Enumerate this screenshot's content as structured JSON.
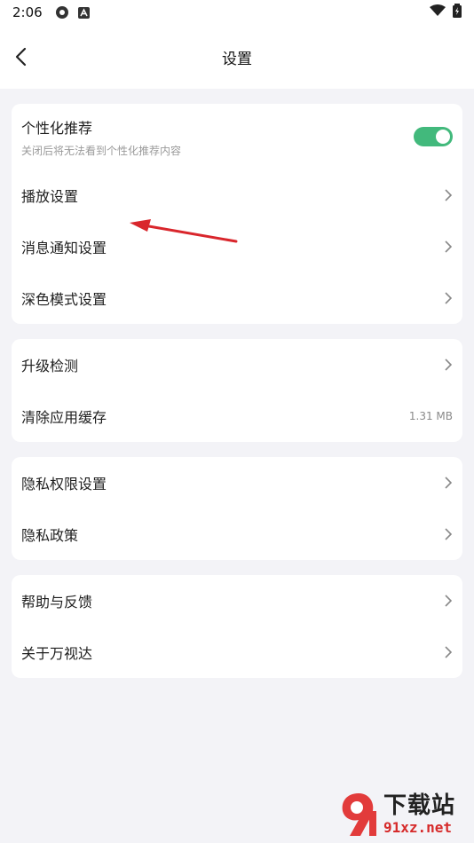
{
  "status_bar": {
    "time": "2:06",
    "icons": [
      "settings-gear-icon",
      "notification-a-icon"
    ],
    "right_icons": [
      "wifi-icon",
      "battery-charging-icon"
    ]
  },
  "header": {
    "title": "设置",
    "back_icon": "chevron-left-icon"
  },
  "cards": [
    {
      "items": [
        {
          "label": "个性化推荐",
          "sub": "关闭后将无法看到个性化推荐内容",
          "control": "toggle",
          "on": true
        },
        {
          "label": "播放设置",
          "control": "chevron"
        },
        {
          "label": "消息通知设置",
          "control": "chevron"
        },
        {
          "label": "深色模式设置",
          "control": "chevron"
        }
      ]
    },
    {
      "items": [
        {
          "label": "升级检测",
          "control": "chevron"
        },
        {
          "label": "清除应用缓存",
          "value": "1.31 MB"
        }
      ]
    },
    {
      "items": [
        {
          "label": "隐私权限设置",
          "control": "chevron"
        },
        {
          "label": "隐私政策",
          "control": "chevron"
        }
      ]
    },
    {
      "items": [
        {
          "label": "帮助与反馈",
          "control": "chevron"
        },
        {
          "label": "关于万视达",
          "control": "chevron"
        }
      ]
    }
  ],
  "watermark": {
    "big": "下载站",
    "small": "91xz.net",
    "logo_icon": "91-logo-icon"
  },
  "colors": {
    "toggle_on": "#42b97c",
    "annotation_arrow": "#d9262c",
    "page_bg": "#f3f3f7"
  }
}
